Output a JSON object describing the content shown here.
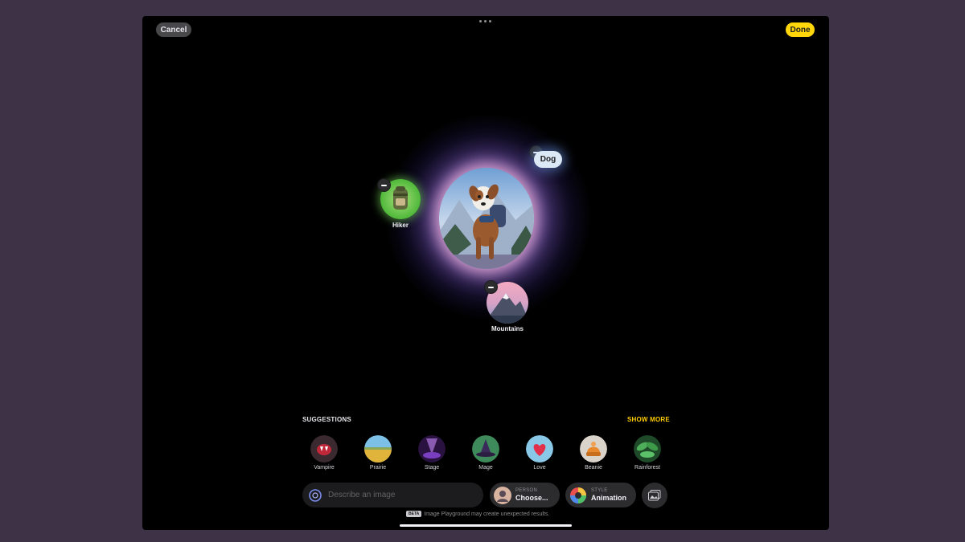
{
  "toolbar": {
    "cancel_label": "Cancel",
    "done_label": "Done"
  },
  "canvas": {
    "main_image": "dog-with-backpack",
    "concepts": [
      {
        "label": "Dog",
        "icon": "dog-icon"
      },
      {
        "label": "Hiker",
        "icon": "backpack-icon"
      },
      {
        "label": "Mountains",
        "icon": "mountain-icon"
      }
    ]
  },
  "suggestions": {
    "title": "SUGGESTIONS",
    "show_more": "SHOW MORE",
    "items": [
      {
        "label": "Vampire",
        "icon": "vampire-icon"
      },
      {
        "label": "Prairie",
        "icon": "prairie-icon"
      },
      {
        "label": "Stage",
        "icon": "stage-icon"
      },
      {
        "label": "Mage",
        "icon": "mage-hat-icon"
      },
      {
        "label": "Love",
        "icon": "heart-icon"
      },
      {
        "label": "Beanie",
        "icon": "beanie-icon"
      },
      {
        "label": "Rainforest",
        "icon": "rainforest-icon"
      }
    ]
  },
  "input": {
    "placeholder": "Describe an image",
    "value": ""
  },
  "person": {
    "caption": "PERSON",
    "value": "Choose..."
  },
  "style": {
    "caption": "STYLE",
    "value": "Animation"
  },
  "footer": {
    "beta": "BETA",
    "disclaimer": "Image Playground may create unexpected results."
  },
  "colors": {
    "accent": "#ffcc00",
    "done_button": "#ffd60a",
    "background": "#000000"
  }
}
